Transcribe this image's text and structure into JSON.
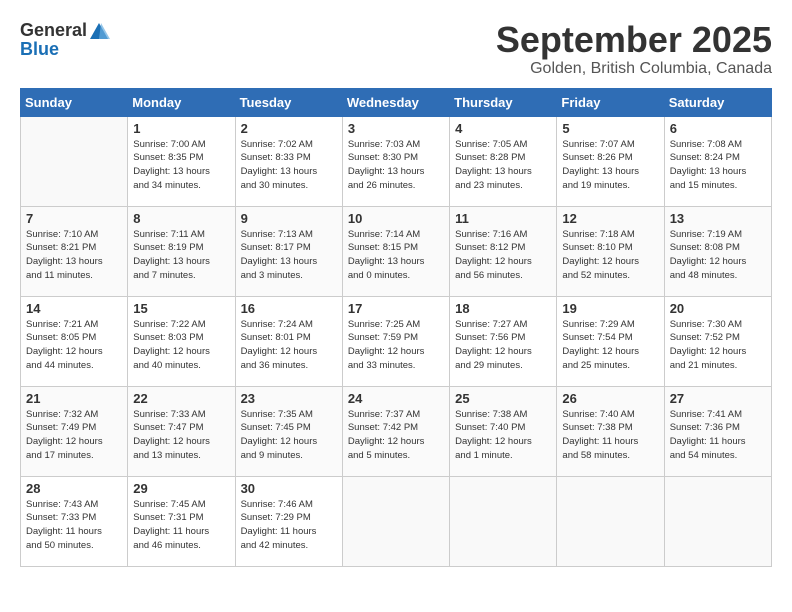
{
  "header": {
    "logo_general": "General",
    "logo_blue": "Blue",
    "month_title": "September 2025",
    "location": "Golden, British Columbia, Canada"
  },
  "weekdays": [
    "Sunday",
    "Monday",
    "Tuesday",
    "Wednesday",
    "Thursday",
    "Friday",
    "Saturday"
  ],
  "weeks": [
    [
      {
        "day": "",
        "info": ""
      },
      {
        "day": "1",
        "info": "Sunrise: 7:00 AM\nSunset: 8:35 PM\nDaylight: 13 hours\nand 34 minutes."
      },
      {
        "day": "2",
        "info": "Sunrise: 7:02 AM\nSunset: 8:33 PM\nDaylight: 13 hours\nand 30 minutes."
      },
      {
        "day": "3",
        "info": "Sunrise: 7:03 AM\nSunset: 8:30 PM\nDaylight: 13 hours\nand 26 minutes."
      },
      {
        "day": "4",
        "info": "Sunrise: 7:05 AM\nSunset: 8:28 PM\nDaylight: 13 hours\nand 23 minutes."
      },
      {
        "day": "5",
        "info": "Sunrise: 7:07 AM\nSunset: 8:26 PM\nDaylight: 13 hours\nand 19 minutes."
      },
      {
        "day": "6",
        "info": "Sunrise: 7:08 AM\nSunset: 8:24 PM\nDaylight: 13 hours\nand 15 minutes."
      }
    ],
    [
      {
        "day": "7",
        "info": "Sunrise: 7:10 AM\nSunset: 8:21 PM\nDaylight: 13 hours\nand 11 minutes."
      },
      {
        "day": "8",
        "info": "Sunrise: 7:11 AM\nSunset: 8:19 PM\nDaylight: 13 hours\nand 7 minutes."
      },
      {
        "day": "9",
        "info": "Sunrise: 7:13 AM\nSunset: 8:17 PM\nDaylight: 13 hours\nand 3 minutes."
      },
      {
        "day": "10",
        "info": "Sunrise: 7:14 AM\nSunset: 8:15 PM\nDaylight: 13 hours\nand 0 minutes."
      },
      {
        "day": "11",
        "info": "Sunrise: 7:16 AM\nSunset: 8:12 PM\nDaylight: 12 hours\nand 56 minutes."
      },
      {
        "day": "12",
        "info": "Sunrise: 7:18 AM\nSunset: 8:10 PM\nDaylight: 12 hours\nand 52 minutes."
      },
      {
        "day": "13",
        "info": "Sunrise: 7:19 AM\nSunset: 8:08 PM\nDaylight: 12 hours\nand 48 minutes."
      }
    ],
    [
      {
        "day": "14",
        "info": "Sunrise: 7:21 AM\nSunset: 8:05 PM\nDaylight: 12 hours\nand 44 minutes."
      },
      {
        "day": "15",
        "info": "Sunrise: 7:22 AM\nSunset: 8:03 PM\nDaylight: 12 hours\nand 40 minutes."
      },
      {
        "day": "16",
        "info": "Sunrise: 7:24 AM\nSunset: 8:01 PM\nDaylight: 12 hours\nand 36 minutes."
      },
      {
        "day": "17",
        "info": "Sunrise: 7:25 AM\nSunset: 7:59 PM\nDaylight: 12 hours\nand 33 minutes."
      },
      {
        "day": "18",
        "info": "Sunrise: 7:27 AM\nSunset: 7:56 PM\nDaylight: 12 hours\nand 29 minutes."
      },
      {
        "day": "19",
        "info": "Sunrise: 7:29 AM\nSunset: 7:54 PM\nDaylight: 12 hours\nand 25 minutes."
      },
      {
        "day": "20",
        "info": "Sunrise: 7:30 AM\nSunset: 7:52 PM\nDaylight: 12 hours\nand 21 minutes."
      }
    ],
    [
      {
        "day": "21",
        "info": "Sunrise: 7:32 AM\nSunset: 7:49 PM\nDaylight: 12 hours\nand 17 minutes."
      },
      {
        "day": "22",
        "info": "Sunrise: 7:33 AM\nSunset: 7:47 PM\nDaylight: 12 hours\nand 13 minutes."
      },
      {
        "day": "23",
        "info": "Sunrise: 7:35 AM\nSunset: 7:45 PM\nDaylight: 12 hours\nand 9 minutes."
      },
      {
        "day": "24",
        "info": "Sunrise: 7:37 AM\nSunset: 7:42 PM\nDaylight: 12 hours\nand 5 minutes."
      },
      {
        "day": "25",
        "info": "Sunrise: 7:38 AM\nSunset: 7:40 PM\nDaylight: 12 hours\nand 1 minute."
      },
      {
        "day": "26",
        "info": "Sunrise: 7:40 AM\nSunset: 7:38 PM\nDaylight: 11 hours\nand 58 minutes."
      },
      {
        "day": "27",
        "info": "Sunrise: 7:41 AM\nSunset: 7:36 PM\nDaylight: 11 hours\nand 54 minutes."
      }
    ],
    [
      {
        "day": "28",
        "info": "Sunrise: 7:43 AM\nSunset: 7:33 PM\nDaylight: 11 hours\nand 50 minutes."
      },
      {
        "day": "29",
        "info": "Sunrise: 7:45 AM\nSunset: 7:31 PM\nDaylight: 11 hours\nand 46 minutes."
      },
      {
        "day": "30",
        "info": "Sunrise: 7:46 AM\nSunset: 7:29 PM\nDaylight: 11 hours\nand 42 minutes."
      },
      {
        "day": "",
        "info": ""
      },
      {
        "day": "",
        "info": ""
      },
      {
        "day": "",
        "info": ""
      },
      {
        "day": "",
        "info": ""
      }
    ]
  ]
}
